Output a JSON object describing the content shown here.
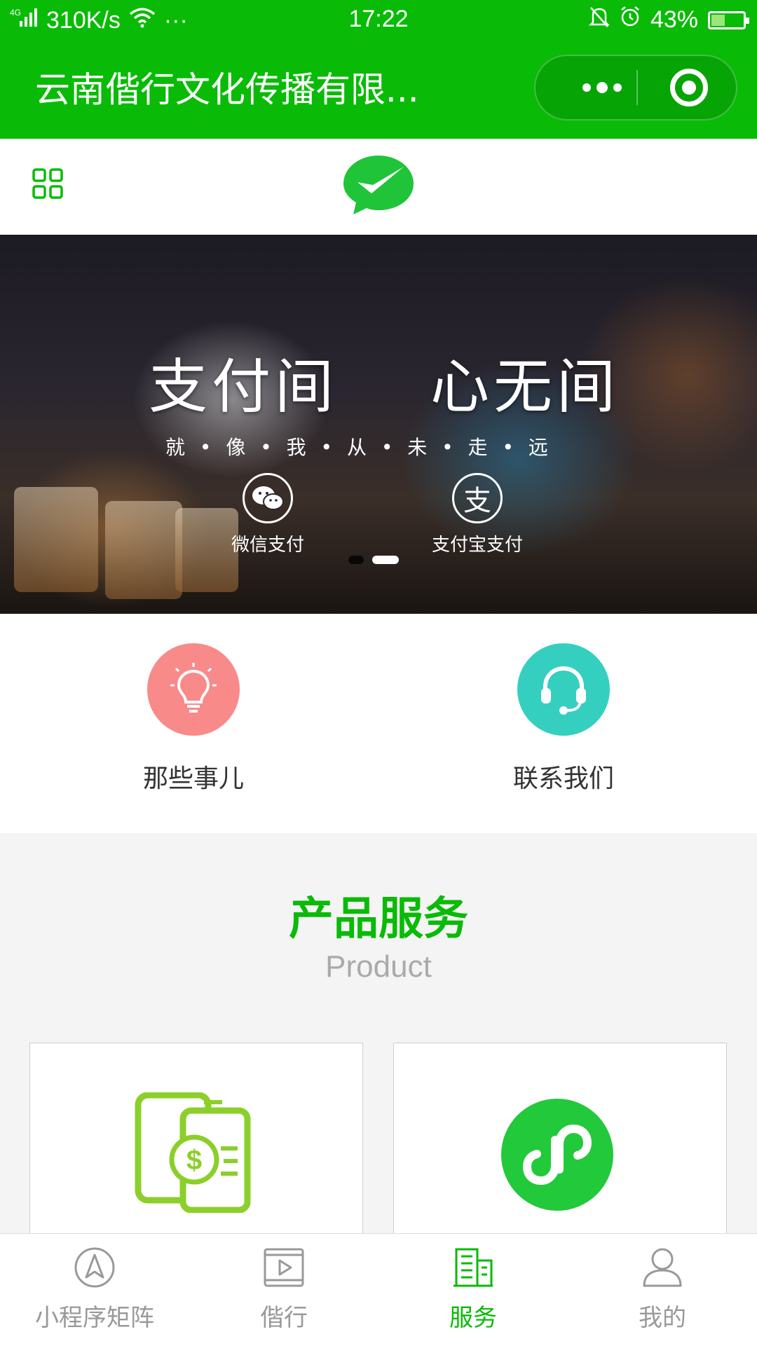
{
  "status_bar": {
    "network": "4G",
    "speed": "310K/s",
    "more": "···",
    "time": "17:22",
    "battery": "43%",
    "battery_level": 0.43
  },
  "navbar": {
    "title": "云南偕行文化传播有限..."
  },
  "banner": {
    "headline_left": "支付间",
    "headline_right": "心无间",
    "slogan": "就 • 像 • 我 • 从 • 未 • 走 • 远",
    "wechat_pay_label": "微信支付",
    "alipay_label": "支付宝支付",
    "alipay_glyph": "支",
    "active_slide": 2,
    "slide_count": 2
  },
  "quick_links": [
    {
      "label": "那些事儿",
      "icon": "lightbulb-icon",
      "color": "#f88a8a"
    },
    {
      "label": "联系我们",
      "icon": "headset-icon",
      "color": "#35cfc0"
    }
  ],
  "section": {
    "title": "产品服务",
    "subtitle": "Product"
  },
  "products": [
    {
      "icon": "mobile-payment-icon",
      "color": "#8ccf2a"
    },
    {
      "icon": "mini-program-icon",
      "color": "#22c93a"
    }
  ],
  "tabbar": [
    {
      "label": "小程序矩阵",
      "icon": "compass-icon",
      "active": false
    },
    {
      "label": "偕行",
      "icon": "video-icon",
      "active": false
    },
    {
      "label": "服务",
      "icon": "building-icon",
      "active": true
    },
    {
      "label": "我的",
      "icon": "user-icon",
      "active": false
    }
  ],
  "colors": {
    "brand_green": "#09bb07",
    "tab_inactive": "#999999"
  }
}
